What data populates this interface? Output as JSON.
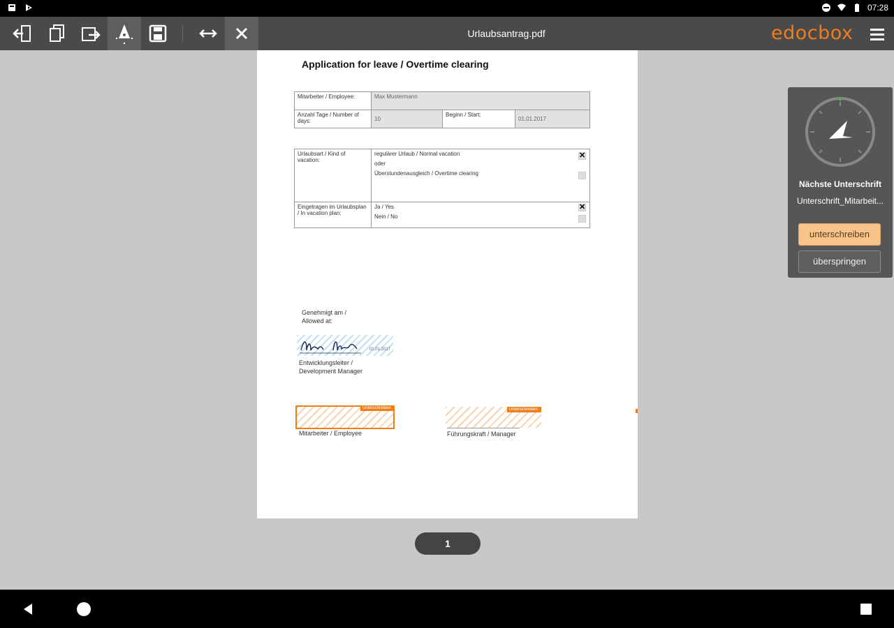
{
  "status_bar": {
    "time": "07:28"
  },
  "toolbar": {
    "document_title": "Urlaubsantrag.pdf",
    "brand": "edocbox"
  },
  "document": {
    "heading": "Application for leave / Overtime clearing",
    "table1": {
      "employee_label": "Mitarbeiter / Employee:",
      "employee_value": "Max Mustermann",
      "days_label": "Anzahl Tage / Number of days:",
      "days_value": "10",
      "start_label": "Beginn / Start:",
      "start_value": "01.01.2017"
    },
    "table2": {
      "kind_label": "Urlaubsart / Kind of vacation:",
      "option_regular": "regulärer Urlaub / Normal vacation",
      "or_text": "oder",
      "option_overtime": "Überstundenausgleich / Overtime clearing",
      "entered_label": "Eingetragen im Urlaubsplan / In vacation plan:",
      "yes": "Ja / Yes",
      "no": "Nein / No",
      "checked_mark": "✕"
    },
    "allowed_label": "Genehmigt am / Allowed at:",
    "manager_sig_date": "01.01.2017",
    "dev_manager_label": "Entwicklungsleiter / Development Manager",
    "employee_sig_label": "Mitarbeiter / Employee",
    "manager_sig_label": "Führungskraft / Manager",
    "sign_flag": "Unterschreiben"
  },
  "sign_panel": {
    "title": "Nächste Unterschrift",
    "subtitle": "Unterschrift_Mitarbeit...",
    "sign_button": "unterschreiben",
    "skip_button": "überspringen"
  },
  "pager": {
    "page": "1"
  },
  "colors": {
    "accent": "#ef7d1a",
    "toolbar": "#4a4a4a",
    "panel": "#565656"
  }
}
